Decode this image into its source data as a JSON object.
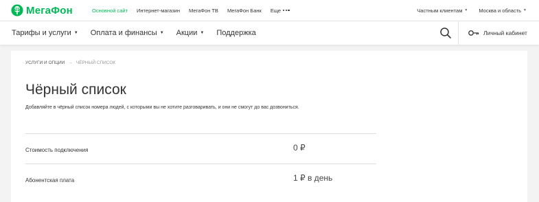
{
  "brand": {
    "name": "МегаФон",
    "color": "#00b956"
  },
  "topnav": {
    "items": [
      {
        "label": "Основной сайт",
        "active": true
      },
      {
        "label": "Интернет-магазин",
        "active": false
      },
      {
        "label": "МегаФон ТВ",
        "active": false
      },
      {
        "label": "МегаФон Банк",
        "active": false
      },
      {
        "label": "Еще",
        "active": false
      }
    ],
    "right": [
      {
        "label": "Частным клиентам"
      },
      {
        "label": "Москва и область"
      }
    ]
  },
  "mainnav": {
    "items": [
      {
        "label": "Тарифы и услуги"
      },
      {
        "label": "Оплата и финансы"
      },
      {
        "label": "Акции"
      },
      {
        "label": "Поддержка"
      }
    ],
    "search_icon": "search-icon",
    "cabinet_label": "Личный кабинет"
  },
  "breadcrumb": {
    "parent": "УСЛУГИ И ОПЦИИ",
    "separator": "→",
    "current": "ЧЁРНЫЙ СПИСОК"
  },
  "page": {
    "title": "Чёрный список",
    "description": "Добавляйте в чёрный список номера людей, с которыми вы не хотите разговаривать, и они не смогут до вас дозвониться."
  },
  "pricing": [
    {
      "label": "Стоимость подключения",
      "value": "0 ₽"
    },
    {
      "label": "Абонентская плата",
      "value": "1 ₽ в день"
    }
  ]
}
